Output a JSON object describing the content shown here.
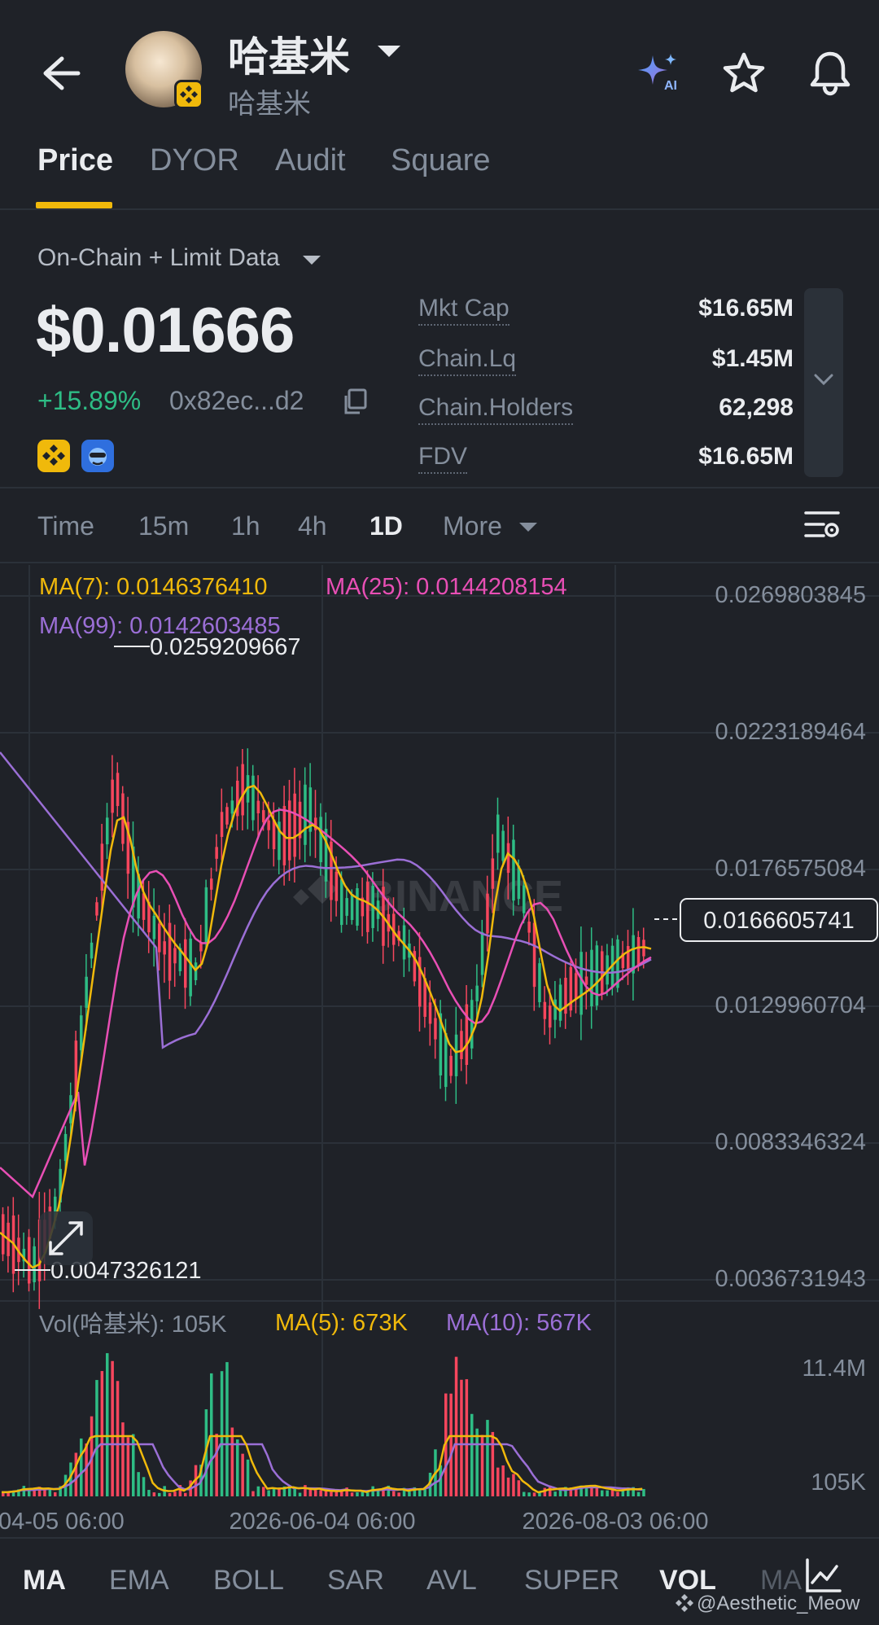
{
  "header": {
    "title": "哈基米",
    "subtitle": "哈基米"
  },
  "tabs": [
    {
      "label": "Price",
      "active": true
    },
    {
      "label": "DYOR",
      "active": false
    },
    {
      "label": "Audit",
      "active": false
    },
    {
      "label": "Square",
      "active": false
    }
  ],
  "data_source": "On-Chain + Limit Data",
  "price": {
    "value": "$0.01666",
    "change": "+15.89%",
    "address": "0x82ec...d2"
  },
  "stats": [
    {
      "label": "Mkt Cap",
      "value": "$16.65M"
    },
    {
      "label": "Chain.Lq",
      "value": "$1.45M"
    },
    {
      "label": "Chain.Holders",
      "value": "62,298"
    },
    {
      "label": "FDV",
      "value": "$16.65M"
    }
  ],
  "timeframes": [
    {
      "label": "Time",
      "active": false
    },
    {
      "label": "15m",
      "active": false
    },
    {
      "label": "1h",
      "active": false
    },
    {
      "label": "4h",
      "active": false
    },
    {
      "label": "1D",
      "active": true
    },
    {
      "label": "More",
      "active": false
    }
  ],
  "chart": {
    "ma7_label": "MA(7): 0.0146376410",
    "ma25_label": "MA(25): 0.0144208154",
    "ma99_label": "MA(99): 0.0142603485",
    "high_label": "0.0259209667",
    "low_label": "0.0047326121",
    "current_price_label": "0.0166605741",
    "watermark": "BINANCE",
    "price_axis": [
      "0.0269803845",
      "0.0223189464",
      "0.0176575084",
      "0.0129960704",
      "0.0083346324",
      "0.0036731943"
    ],
    "vol_label": "Vol(哈基米): 105K",
    "vol_ma5_label": "MA(5): 673K",
    "vol_ma10_label": "MA(10): 567K",
    "vol_axis": [
      "11.4M",
      "105K"
    ],
    "date_axis": [
      "04-05 06:00",
      "2026-06-04 06:00",
      "2026-08-03 06:00"
    ],
    "colors": {
      "up": "#2ebd85",
      "down": "#f6465d",
      "ma7": "#f0b90b",
      "ma25": "#e84fb5",
      "ma99": "#9b6fd6"
    }
  },
  "indicators": [
    {
      "label": "MA",
      "active": true
    },
    {
      "label": "EMA",
      "active": false
    },
    {
      "label": "BOLL",
      "active": false
    },
    {
      "label": "SAR",
      "active": false
    },
    {
      "label": "AVL",
      "active": false
    },
    {
      "label": "SUPER",
      "active": false
    },
    {
      "label": "VOL",
      "active": true
    },
    {
      "label": "MA",
      "active": false
    }
  ],
  "footer_watermark": "@Aesthetic_Meow"
}
